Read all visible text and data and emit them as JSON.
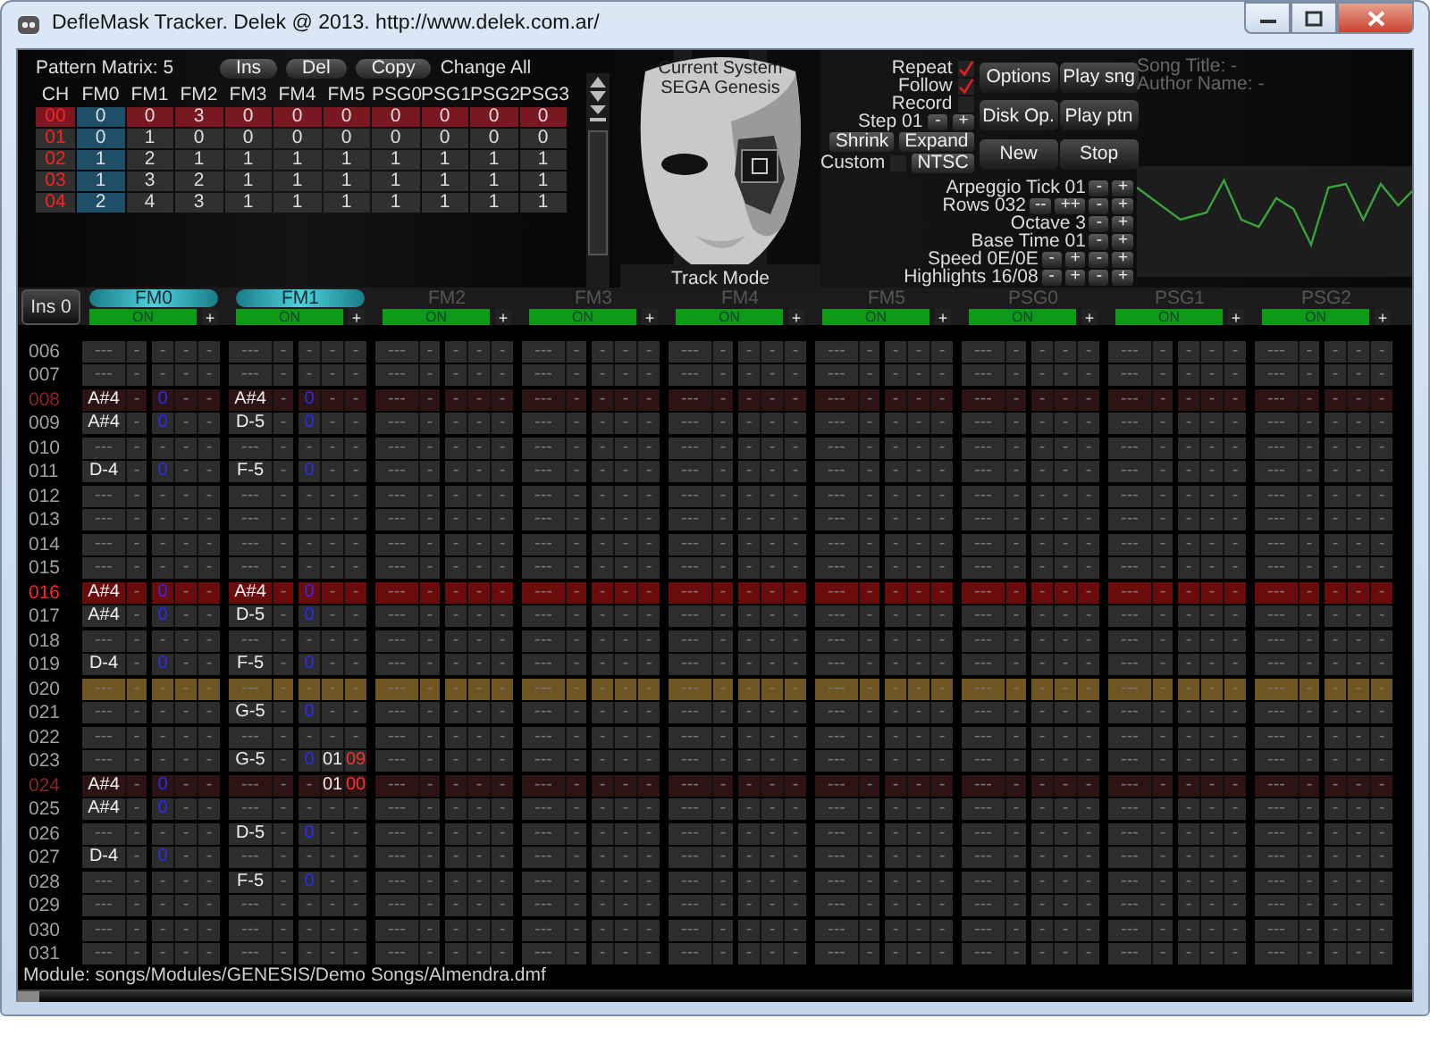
{
  "window": {
    "title": "DefleMask Tracker. Delek @ 2013. http://www.delek.com.ar/"
  },
  "matrix": {
    "label": "Pattern Matrix: 5",
    "buttons": [
      "Ins",
      "Del",
      "Copy"
    ],
    "change_all": "Change All",
    "header": "CH",
    "channels": [
      {
        "label": "FM0",
        "selected": true
      },
      {
        "label": "FM1",
        "selected": false
      },
      {
        "label": "FM2",
        "selected": false
      },
      {
        "label": "FM3",
        "selected": false
      },
      {
        "label": "FM4",
        "selected": false
      },
      {
        "label": "FM5",
        "selected": false
      },
      {
        "label": "PSG0",
        "selected": false
      },
      {
        "label": "PSG1",
        "selected": false
      },
      {
        "label": "PSG2",
        "selected": false
      },
      {
        "label": "PSG3",
        "selected": false
      }
    ],
    "rows": [
      {
        "ch": "00",
        "selected": true,
        "values": [
          "0",
          "0",
          "3",
          "0",
          "0",
          "0",
          "0",
          "0",
          "0",
          "0"
        ]
      },
      {
        "ch": "01",
        "selected": false,
        "values": [
          "0",
          "1",
          "0",
          "0",
          "0",
          "0",
          "0",
          "0",
          "0",
          "0"
        ]
      },
      {
        "ch": "02",
        "selected": false,
        "values": [
          "1",
          "2",
          "1",
          "1",
          "1",
          "1",
          "1",
          "1",
          "1",
          "1"
        ]
      },
      {
        "ch": "03",
        "selected": false,
        "values": [
          "1",
          "3",
          "2",
          "1",
          "1",
          "1",
          "1",
          "1",
          "1",
          "1"
        ]
      },
      {
        "ch": "04",
        "selected": false,
        "values": [
          "2",
          "4",
          "3",
          "1",
          "1",
          "1",
          "1",
          "1",
          "1",
          "1"
        ]
      }
    ]
  },
  "system": {
    "lines": [
      "Current System",
      "SEGA Genesis"
    ],
    "mode": "Track Mode"
  },
  "toggles": [
    {
      "label": "Repeat",
      "checked": true
    },
    {
      "label": "Follow",
      "checked": true
    },
    {
      "label": "Record",
      "checked": false
    }
  ],
  "step": {
    "label": "Step 01",
    "buttons": [
      "-",
      "+"
    ]
  },
  "pattern_buttons": [
    "Shrink",
    "Expand"
  ],
  "custom": {
    "label": "Custom",
    "checked": false,
    "button": "NTSC"
  },
  "buttons": [
    "Options",
    "Play sng",
    "Disk Op.",
    "Play ptn",
    "New",
    "Stop"
  ],
  "song_info": [
    "Song Title: -",
    "Author Name: -"
  ],
  "settings": [
    {
      "label": "Arpeggio Tick 01",
      "buttons": [
        "-",
        "+"
      ]
    },
    {
      "label": "Rows 032",
      "buttons": [
        "--",
        "++",
        "-",
        "+"
      ]
    },
    {
      "label": "Octave 3",
      "buttons": [
        "-",
        "+"
      ]
    },
    {
      "label": "Base Time 01",
      "buttons": [
        "-",
        "+"
      ]
    },
    {
      "label": "Speed 0E/0E",
      "buttons": [
        "-",
        "+",
        "-",
        "+"
      ]
    },
    {
      "label": "Highlights 16/08",
      "buttons": [
        "-",
        "+",
        "-",
        "+"
      ]
    }
  ],
  "instrument_button": "Ins 0",
  "channels": [
    {
      "name": "FM0",
      "active": true,
      "status": "ON",
      "button": "+"
    },
    {
      "name": "FM1",
      "active": true,
      "status": "ON",
      "button": "+"
    },
    {
      "name": "FM2",
      "active": false,
      "status": "ON",
      "button": "+"
    },
    {
      "name": "FM3",
      "active": false,
      "status": "ON",
      "button": "+"
    },
    {
      "name": "FM4",
      "active": false,
      "status": "ON",
      "button": "+"
    },
    {
      "name": "FM5",
      "active": false,
      "status": "ON",
      "button": "+"
    },
    {
      "name": "PSG0",
      "active": false,
      "status": "ON",
      "button": "+"
    },
    {
      "name": "PSG1",
      "active": false,
      "status": "ON",
      "button": "+"
    },
    {
      "name": "PSG2",
      "active": false,
      "status": "ON",
      "button": "+"
    }
  ],
  "pattern": {
    "rows": [
      {
        "num": "006",
        "kind": "normal",
        "cells": [
          [
            "---",
            "-",
            "-",
            "-",
            "-"
          ],
          [
            "---",
            "-",
            "-",
            "-",
            "-"
          ],
          [
            "---",
            "-",
            "-",
            "-",
            "-"
          ],
          [
            "---",
            "-",
            "-",
            "-",
            "-"
          ],
          [
            "---",
            "-",
            "-",
            "-",
            "-"
          ],
          [
            "---",
            "-",
            "-",
            "-",
            "-"
          ],
          [
            "---",
            "-",
            "-",
            "-",
            "-"
          ],
          [
            "---",
            "-",
            "-",
            "-",
            "-"
          ],
          [
            "---",
            "-",
            "-",
            "-",
            "-"
          ]
        ]
      },
      {
        "num": "007",
        "kind": "normal",
        "cells": [
          [
            "---",
            "-",
            "-",
            "-",
            "-"
          ],
          [
            "---",
            "-",
            "-",
            "-",
            "-"
          ],
          [
            "---",
            "-",
            "-",
            "-",
            "-"
          ],
          [
            "---",
            "-",
            "-",
            "-",
            "-"
          ],
          [
            "---",
            "-",
            "-",
            "-",
            "-"
          ],
          [
            "---",
            "-",
            "-",
            "-",
            "-"
          ],
          [
            "---",
            "-",
            "-",
            "-",
            "-"
          ],
          [
            "---",
            "-",
            "-",
            "-",
            "-"
          ],
          [
            "---",
            "-",
            "-",
            "-",
            "-"
          ]
        ]
      },
      {
        "num": "008",
        "kind": "beat",
        "cells": [
          {
            "fields": [
              "A#4",
              "-",
              "0",
              "-",
              "-"
            ],
            "entered": [
              true,
              false,
              true,
              false,
              false
            ]
          },
          {
            "fields": [
              "A#4",
              "-",
              "0",
              "-",
              "-"
            ],
            "entered": [
              true,
              false,
              true,
              false,
              false
            ]
          },
          [
            "---",
            "-",
            "-",
            "-",
            "-"
          ],
          [
            "---",
            "-",
            "-",
            "-",
            "-"
          ],
          [
            "---",
            "-",
            "-",
            "-",
            "-"
          ],
          [
            "---",
            "-",
            "-",
            "-",
            "-"
          ],
          [
            "---",
            "-",
            "-",
            "-",
            "-"
          ],
          [
            "---",
            "-",
            "-",
            "-",
            "-"
          ],
          [
            "---",
            "-",
            "-",
            "-",
            "-"
          ]
        ]
      },
      {
        "num": "009",
        "kind": "normal",
        "cells": [
          {
            "fields": [
              "A#4",
              "-",
              "0",
              "-",
              "-"
            ],
            "entered": [
              true,
              false,
              true,
              false,
              false
            ]
          },
          {
            "fields": [
              "D-5",
              "-",
              "0",
              "-",
              "-"
            ],
            "entered": [
              true,
              false,
              true,
              false,
              false
            ]
          },
          [
            "---",
            "-",
            "-",
            "-",
            "-"
          ],
          [
            "---",
            "-",
            "-",
            "-",
            "-"
          ],
          [
            "---",
            "-",
            "-",
            "-",
            "-"
          ],
          [
            "---",
            "-",
            "-",
            "-",
            "-"
          ],
          [
            "---",
            "-",
            "-",
            "-",
            "-"
          ],
          [
            "---",
            "-",
            "-",
            "-",
            "-"
          ],
          [
            "---",
            "-",
            "-",
            "-",
            "-"
          ]
        ]
      },
      {
        "num": "010",
        "kind": "normal",
        "cells": [
          [
            "---",
            "-",
            "-",
            "-",
            "-"
          ],
          [
            "---",
            "-",
            "-",
            "-",
            "-"
          ],
          [
            "---",
            "-",
            "-",
            "-",
            "-"
          ],
          [
            "---",
            "-",
            "-",
            "-",
            "-"
          ],
          [
            "---",
            "-",
            "-",
            "-",
            "-"
          ],
          [
            "---",
            "-",
            "-",
            "-",
            "-"
          ],
          [
            "---",
            "-",
            "-",
            "-",
            "-"
          ],
          [
            "---",
            "-",
            "-",
            "-",
            "-"
          ],
          [
            "---",
            "-",
            "-",
            "-",
            "-"
          ]
        ]
      },
      {
        "num": "011",
        "kind": "normal",
        "cells": [
          {
            "fields": [
              "D-4",
              "-",
              "0",
              "-",
              "-"
            ],
            "entered": [
              true,
              false,
              true,
              false,
              false
            ]
          },
          {
            "fields": [
              "F-5",
              "-",
              "0",
              "-",
              "-"
            ],
            "entered": [
              true,
              false,
              true,
              false,
              false
            ]
          },
          [
            "---",
            "-",
            "-",
            "-",
            "-"
          ],
          [
            "---",
            "-",
            "-",
            "-",
            "-"
          ],
          [
            "---",
            "-",
            "-",
            "-",
            "-"
          ],
          [
            "---",
            "-",
            "-",
            "-",
            "-"
          ],
          [
            "---",
            "-",
            "-",
            "-",
            "-"
          ],
          [
            "---",
            "-",
            "-",
            "-",
            "-"
          ],
          [
            "---",
            "-",
            "-",
            "-",
            "-"
          ]
        ]
      },
      {
        "num": "012",
        "kind": "normal",
        "cells": [
          [
            "---",
            "-",
            "-",
            "-",
            "-"
          ],
          [
            "---",
            "-",
            "-",
            "-",
            "-"
          ],
          [
            "---",
            "-",
            "-",
            "-",
            "-"
          ],
          [
            "---",
            "-",
            "-",
            "-",
            "-"
          ],
          [
            "---",
            "-",
            "-",
            "-",
            "-"
          ],
          [
            "---",
            "-",
            "-",
            "-",
            "-"
          ],
          [
            "---",
            "-",
            "-",
            "-",
            "-"
          ],
          [
            "---",
            "-",
            "-",
            "-",
            "-"
          ],
          [
            "---",
            "-",
            "-",
            "-",
            "-"
          ]
        ]
      },
      {
        "num": "013",
        "kind": "normal",
        "cells": [
          [
            "---",
            "-",
            "-",
            "-",
            "-"
          ],
          [
            "---",
            "-",
            "-",
            "-",
            "-"
          ],
          [
            "---",
            "-",
            "-",
            "-",
            "-"
          ],
          [
            "---",
            "-",
            "-",
            "-",
            "-"
          ],
          [
            "---",
            "-",
            "-",
            "-",
            "-"
          ],
          [
            "---",
            "-",
            "-",
            "-",
            "-"
          ],
          [
            "---",
            "-",
            "-",
            "-",
            "-"
          ],
          [
            "---",
            "-",
            "-",
            "-",
            "-"
          ],
          [
            "---",
            "-",
            "-",
            "-",
            "-"
          ]
        ]
      },
      {
        "num": "014",
        "kind": "normal",
        "cells": [
          [
            "---",
            "-",
            "-",
            "-",
            "-"
          ],
          [
            "---",
            "-",
            "-",
            "-",
            "-"
          ],
          [
            "---",
            "-",
            "-",
            "-",
            "-"
          ],
          [
            "---",
            "-",
            "-",
            "-",
            "-"
          ],
          [
            "---",
            "-",
            "-",
            "-",
            "-"
          ],
          [
            "---",
            "-",
            "-",
            "-",
            "-"
          ],
          [
            "---",
            "-",
            "-",
            "-",
            "-"
          ],
          [
            "---",
            "-",
            "-",
            "-",
            "-"
          ],
          [
            "---",
            "-",
            "-",
            "-",
            "-"
          ]
        ]
      },
      {
        "num": "015",
        "kind": "normal",
        "cells": [
          [
            "---",
            "-",
            "-",
            "-",
            "-"
          ],
          [
            "---",
            "-",
            "-",
            "-",
            "-"
          ],
          [
            "---",
            "-",
            "-",
            "-",
            "-"
          ],
          [
            "---",
            "-",
            "-",
            "-",
            "-"
          ],
          [
            "---",
            "-",
            "-",
            "-",
            "-"
          ],
          [
            "---",
            "-",
            "-",
            "-",
            "-"
          ],
          [
            "---",
            "-",
            "-",
            "-",
            "-"
          ],
          [
            "---",
            "-",
            "-",
            "-",
            "-"
          ],
          [
            "---",
            "-",
            "-",
            "-",
            "-"
          ]
        ]
      },
      {
        "num": "016",
        "kind": "bar",
        "cells": [
          {
            "fields": [
              "A#4",
              "-",
              "0",
              "-",
              "-"
            ],
            "entered": [
              true,
              false,
              true,
              false,
              false
            ]
          },
          {
            "fields": [
              "A#4",
              "-",
              "0",
              "-",
              "-"
            ],
            "entered": [
              true,
              false,
              true,
              false,
              false
            ]
          },
          [
            "---",
            "-",
            "-",
            "-",
            "-"
          ],
          [
            "---",
            "-",
            "-",
            "-",
            "-"
          ],
          [
            "---",
            "-",
            "-",
            "-",
            "-"
          ],
          [
            "---",
            "-",
            "-",
            "-",
            "-"
          ],
          [
            "---",
            "-",
            "-",
            "-",
            "-"
          ],
          [
            "---",
            "-",
            "-",
            "-",
            "-"
          ],
          [
            "---",
            "-",
            "-",
            "-",
            "-"
          ]
        ]
      },
      {
        "num": "017",
        "kind": "normal",
        "cells": [
          {
            "fields": [
              "A#4",
              "-",
              "0",
              "-",
              "-"
            ],
            "entered": [
              true,
              false,
              true,
              false,
              false
            ]
          },
          {
            "fields": [
              "D-5",
              "-",
              "0",
              "-",
              "-"
            ],
            "entered": [
              true,
              false,
              true,
              false,
              false
            ]
          },
          [
            "---",
            "-",
            "-",
            "-",
            "-"
          ],
          [
            "---",
            "-",
            "-",
            "-",
            "-"
          ],
          [
            "---",
            "-",
            "-",
            "-",
            "-"
          ],
          [
            "---",
            "-",
            "-",
            "-",
            "-"
          ],
          [
            "---",
            "-",
            "-",
            "-",
            "-"
          ],
          [
            "---",
            "-",
            "-",
            "-",
            "-"
          ],
          [
            "---",
            "-",
            "-",
            "-",
            "-"
          ]
        ]
      },
      {
        "num": "018",
        "kind": "normal",
        "cells": [
          [
            "---",
            "-",
            "-",
            "-",
            "-"
          ],
          [
            "---",
            "-",
            "-",
            "-",
            "-"
          ],
          [
            "---",
            "-",
            "-",
            "-",
            "-"
          ],
          [
            "---",
            "-",
            "-",
            "-",
            "-"
          ],
          [
            "---",
            "-",
            "-",
            "-",
            "-"
          ],
          [
            "---",
            "-",
            "-",
            "-",
            "-"
          ],
          [
            "---",
            "-",
            "-",
            "-",
            "-"
          ],
          [
            "---",
            "-",
            "-",
            "-",
            "-"
          ],
          [
            "---",
            "-",
            "-",
            "-",
            "-"
          ]
        ]
      },
      {
        "num": "019",
        "kind": "normal",
        "cells": [
          {
            "fields": [
              "D-4",
              "-",
              "0",
              "-",
              "-"
            ],
            "entered": [
              true,
              false,
              true,
              false,
              false
            ]
          },
          {
            "fields": [
              "F-5",
              "-",
              "0",
              "-",
              "-"
            ],
            "entered": [
              true,
              false,
              true,
              false,
              false
            ]
          },
          [
            "---",
            "-",
            "-",
            "-",
            "-"
          ],
          [
            "---",
            "-",
            "-",
            "-",
            "-"
          ],
          [
            "---",
            "-",
            "-",
            "-",
            "-"
          ],
          [
            "---",
            "-",
            "-",
            "-",
            "-"
          ],
          [
            "---",
            "-",
            "-",
            "-",
            "-"
          ],
          [
            "---",
            "-",
            "-",
            "-",
            "-"
          ],
          [
            "---",
            "-",
            "-",
            "-",
            "-"
          ]
        ]
      },
      {
        "num": "020",
        "kind": "cursor",
        "cells": [
          [
            "---",
            "-",
            "-",
            "-",
            "-"
          ],
          [
            "---",
            "-",
            "-",
            "-",
            "-"
          ],
          [
            "---",
            "-",
            "-",
            "-",
            "-"
          ],
          [
            "---",
            "-",
            "-",
            "-",
            "-"
          ],
          [
            "---",
            "-",
            "-",
            "-",
            "-"
          ],
          [
            "---",
            "-",
            "-",
            "-",
            "-"
          ],
          [
            "---",
            "-",
            "-",
            "-",
            "-"
          ],
          [
            "---",
            "-",
            "-",
            "-",
            "-"
          ],
          [
            "---",
            "-",
            "-",
            "-",
            "-"
          ]
        ]
      },
      {
        "num": "021",
        "kind": "normal",
        "cells": [
          [
            "---",
            "-",
            "-",
            "-",
            "-"
          ],
          {
            "fields": [
              "G-5",
              "-",
              "0",
              "-",
              "-"
            ],
            "entered": [
              true,
              false,
              true,
              false,
              false
            ]
          },
          [
            "---",
            "-",
            "-",
            "-",
            "-"
          ],
          [
            "---",
            "-",
            "-",
            "-",
            "-"
          ],
          [
            "---",
            "-",
            "-",
            "-",
            "-"
          ],
          [
            "---",
            "-",
            "-",
            "-",
            "-"
          ],
          [
            "---",
            "-",
            "-",
            "-",
            "-"
          ],
          [
            "---",
            "-",
            "-",
            "-",
            "-"
          ],
          [
            "---",
            "-",
            "-",
            "-",
            "-"
          ]
        ]
      },
      {
        "num": "022",
        "kind": "normal",
        "cells": [
          [
            "---",
            "-",
            "-",
            "-",
            "-"
          ],
          [
            "---",
            "-",
            "-",
            "-",
            "-"
          ],
          [
            "---",
            "-",
            "-",
            "-",
            "-"
          ],
          [
            "---",
            "-",
            "-",
            "-",
            "-"
          ],
          [
            "---",
            "-",
            "-",
            "-",
            "-"
          ],
          [
            "---",
            "-",
            "-",
            "-",
            "-"
          ],
          [
            "---",
            "-",
            "-",
            "-",
            "-"
          ],
          [
            "---",
            "-",
            "-",
            "-",
            "-"
          ],
          [
            "---",
            "-",
            "-",
            "-",
            "-"
          ]
        ]
      },
      {
        "num": "023",
        "kind": "normal",
        "cells": [
          [
            "---",
            "-",
            "-",
            "-",
            "-"
          ],
          {
            "fields": [
              "G-5",
              "-",
              "0",
              "01",
              "09"
            ],
            "entered": [
              true,
              false,
              true,
              true,
              true
            ]
          },
          [
            "---",
            "-",
            "-",
            "-",
            "-"
          ],
          [
            "---",
            "-",
            "-",
            "-",
            "-"
          ],
          [
            "---",
            "-",
            "-",
            "-",
            "-"
          ],
          [
            "---",
            "-",
            "-",
            "-",
            "-"
          ],
          [
            "---",
            "-",
            "-",
            "-",
            "-"
          ],
          [
            "---",
            "-",
            "-",
            "-",
            "-"
          ],
          [
            "---",
            "-",
            "-",
            "-",
            "-"
          ]
        ]
      },
      {
        "num": "024",
        "kind": "beat",
        "cells": [
          {
            "fields": [
              "A#4",
              "-",
              "0",
              "-",
              "-"
            ],
            "entered": [
              true,
              false,
              true,
              false,
              false
            ]
          },
          {
            "fields": [
              "---",
              "-",
              "-",
              "01",
              "00"
            ],
            "entered": [
              false,
              false,
              false,
              true,
              true
            ]
          },
          [
            "---",
            "-",
            "-",
            "-",
            "-"
          ],
          [
            "---",
            "-",
            "-",
            "-",
            "-"
          ],
          [
            "---",
            "-",
            "-",
            "-",
            "-"
          ],
          [
            "---",
            "-",
            "-",
            "-",
            "-"
          ],
          [
            "---",
            "-",
            "-",
            "-",
            "-"
          ],
          [
            "---",
            "-",
            "-",
            "-",
            "-"
          ],
          [
            "---",
            "-",
            "-",
            "-",
            "-"
          ]
        ]
      },
      {
        "num": "025",
        "kind": "normal",
        "cells": [
          {
            "fields": [
              "A#4",
              "-",
              "0",
              "-",
              "-"
            ],
            "entered": [
              true,
              false,
              true,
              false,
              false
            ]
          },
          [
            "---",
            "-",
            "-",
            "-",
            "-"
          ],
          [
            "---",
            "-",
            "-",
            "-",
            "-"
          ],
          [
            "---",
            "-",
            "-",
            "-",
            "-"
          ],
          [
            "---",
            "-",
            "-",
            "-",
            "-"
          ],
          [
            "---",
            "-",
            "-",
            "-",
            "-"
          ],
          [
            "---",
            "-",
            "-",
            "-",
            "-"
          ],
          [
            "---",
            "-",
            "-",
            "-",
            "-"
          ],
          [
            "---",
            "-",
            "-",
            "-",
            "-"
          ]
        ]
      },
      {
        "num": "026",
        "kind": "normal",
        "cells": [
          [
            "---",
            "-",
            "-",
            "-",
            "-"
          ],
          {
            "fields": [
              "D-5",
              "-",
              "0",
              "-",
              "-"
            ],
            "entered": [
              true,
              false,
              true,
              false,
              false
            ]
          },
          [
            "---",
            "-",
            "-",
            "-",
            "-"
          ],
          [
            "---",
            "-",
            "-",
            "-",
            "-"
          ],
          [
            "---",
            "-",
            "-",
            "-",
            "-"
          ],
          [
            "---",
            "-",
            "-",
            "-",
            "-"
          ],
          [
            "---",
            "-",
            "-",
            "-",
            "-"
          ],
          [
            "---",
            "-",
            "-",
            "-",
            "-"
          ],
          [
            "---",
            "-",
            "-",
            "-",
            "-"
          ]
        ]
      },
      {
        "num": "027",
        "kind": "normal",
        "cells": [
          {
            "fields": [
              "D-4",
              "-",
              "0",
              "-",
              "-"
            ],
            "entered": [
              true,
              false,
              true,
              false,
              false
            ]
          },
          [
            "---",
            "-",
            "-",
            "-",
            "-"
          ],
          [
            "---",
            "-",
            "-",
            "-",
            "-"
          ],
          [
            "---",
            "-",
            "-",
            "-",
            "-"
          ],
          [
            "---",
            "-",
            "-",
            "-",
            "-"
          ],
          [
            "---",
            "-",
            "-",
            "-",
            "-"
          ],
          [
            "---",
            "-",
            "-",
            "-",
            "-"
          ],
          [
            "---",
            "-",
            "-",
            "-",
            "-"
          ],
          [
            "---",
            "-",
            "-",
            "-",
            "-"
          ]
        ]
      },
      {
        "num": "028",
        "kind": "normal",
        "cells": [
          [
            "---",
            "-",
            "-",
            "-",
            "-"
          ],
          {
            "fields": [
              "F-5",
              "-",
              "0",
              "-",
              "-"
            ],
            "entered": [
              true,
              false,
              true,
              false,
              false
            ]
          },
          [
            "---",
            "-",
            "-",
            "-",
            "-"
          ],
          [
            "---",
            "-",
            "-",
            "-",
            "-"
          ],
          [
            "---",
            "-",
            "-",
            "-",
            "-"
          ],
          [
            "---",
            "-",
            "-",
            "-",
            "-"
          ],
          [
            "---",
            "-",
            "-",
            "-",
            "-"
          ],
          [
            "---",
            "-",
            "-",
            "-",
            "-"
          ],
          [
            "---",
            "-",
            "-",
            "-",
            "-"
          ]
        ]
      },
      {
        "num": "029",
        "kind": "normal",
        "cells": [
          [
            "---",
            "-",
            "-",
            "-",
            "-"
          ],
          [
            "---",
            "-",
            "-",
            "-",
            "-"
          ],
          [
            "---",
            "-",
            "-",
            "-",
            "-"
          ],
          [
            "---",
            "-",
            "-",
            "-",
            "-"
          ],
          [
            "---",
            "-",
            "-",
            "-",
            "-"
          ],
          [
            "---",
            "-",
            "-",
            "-",
            "-"
          ],
          [
            "---",
            "-",
            "-",
            "-",
            "-"
          ],
          [
            "---",
            "-",
            "-",
            "-",
            "-"
          ],
          [
            "---",
            "-",
            "-",
            "-",
            "-"
          ]
        ]
      },
      {
        "num": "030",
        "kind": "normal",
        "cells": [
          [
            "---",
            "-",
            "-",
            "-",
            "-"
          ],
          [
            "---",
            "-",
            "-",
            "-",
            "-"
          ],
          [
            "---",
            "-",
            "-",
            "-",
            "-"
          ],
          [
            "---",
            "-",
            "-",
            "-",
            "-"
          ],
          [
            "---",
            "-",
            "-",
            "-",
            "-"
          ],
          [
            "---",
            "-",
            "-",
            "-",
            "-"
          ],
          [
            "---",
            "-",
            "-",
            "-",
            "-"
          ],
          [
            "---",
            "-",
            "-",
            "-",
            "-"
          ],
          [
            "---",
            "-",
            "-",
            "-",
            "-"
          ]
        ]
      },
      {
        "num": "031",
        "kind": "normal",
        "cells": [
          [
            "---",
            "-",
            "-",
            "-",
            "-"
          ],
          [
            "---",
            "-",
            "-",
            "-",
            "-"
          ],
          [
            "---",
            "-",
            "-",
            "-",
            "-"
          ],
          [
            "---",
            "-",
            "-",
            "-",
            "-"
          ],
          [
            "---",
            "-",
            "-",
            "-",
            "-"
          ],
          [
            "---",
            "-",
            "-",
            "-",
            "-"
          ],
          [
            "---",
            "-",
            "-",
            "-",
            "-"
          ],
          [
            "---",
            "-",
            "-",
            "-",
            "-"
          ],
          [
            "---",
            "-",
            "-",
            "-",
            "-"
          ]
        ]
      }
    ]
  },
  "status_bar": "Module: songs/Modules/GENESIS/Demo Songs/Almendra.dmf"
}
